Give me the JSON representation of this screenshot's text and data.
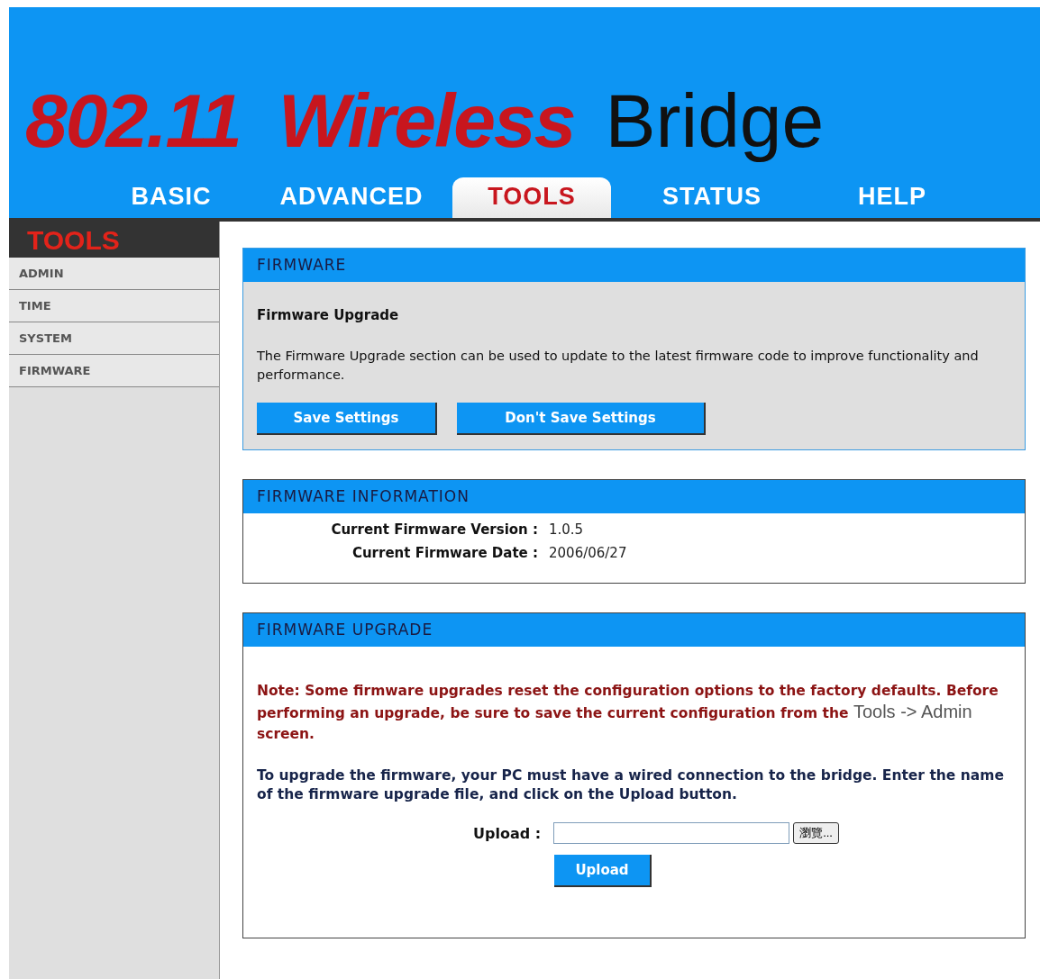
{
  "banner": {
    "title": [
      {
        "text": "802.11",
        "kind": "accent"
      },
      {
        "text": "Wireless",
        "kind": "accent"
      },
      {
        "text": "Bridge",
        "kind": "plain"
      }
    ]
  },
  "tabs": [
    {
      "label": "BASIC",
      "selected": false
    },
    {
      "label": "ADVANCED",
      "selected": false
    },
    {
      "label": "TOOLS",
      "selected": true
    },
    {
      "label": "STATUS",
      "selected": false
    },
    {
      "label": "HELP",
      "selected": false
    }
  ],
  "sidebar": {
    "heading": "TOOLS",
    "items": [
      {
        "label": "ADMIN"
      },
      {
        "label": "TIME"
      },
      {
        "label": "SYSTEM"
      },
      {
        "label": "FIRMWARE"
      }
    ]
  },
  "firmware": {
    "heading": "FIRMWARE",
    "subheading": "Firmware Upgrade",
    "description": "The Firmware Upgrade section can be used to update to the latest firmware code to improve functionality and performance.",
    "buttons": [
      "Save Settings",
      "Don't Save Settings"
    ]
  },
  "firmware_information": {
    "heading": "FIRMWARE INFORMATION",
    "rows": [
      {
        "label": "Current Firmware Version :",
        "value": "1.0.5"
      },
      {
        "label": "Current Firmware Date :",
        "value": "2006/06/27"
      }
    ]
  },
  "firmware_upgrade": {
    "heading": "FIRMWARE UPGRADE",
    "note": {
      "before": "Note: Some firmware upgrades reset the configuration options to the factory defaults. Before performing an upgrade, be sure to save the current configuration from the",
      "link": "Tools -> Admin",
      "after": "screen."
    },
    "instructions": "To upgrade the firmware, your PC must have a wired connection to the bridge. Enter the name of the firmware upgrade file, and click on the Upload button.",
    "upload_label": "Upload :",
    "browse_button": "瀏覽...",
    "upload_button": "Upload"
  }
}
